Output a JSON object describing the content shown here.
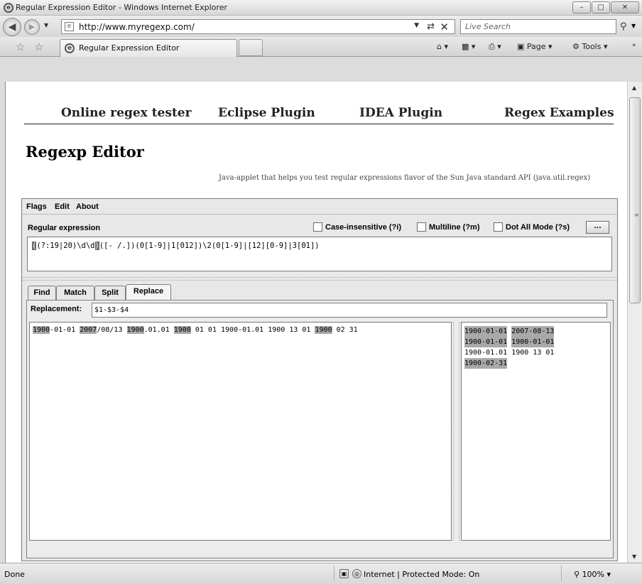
{
  "window": {
    "title": "Regular Expression Editor - Windows Internet Explorer",
    "controls": [
      "minimize",
      "maximize",
      "close"
    ]
  },
  "navigation": {
    "url": "http://www.myregexp.com/",
    "search_placeholder": "Live Search"
  },
  "tab": {
    "title": "Regular Expression Editor"
  },
  "command_bar": {
    "page_label": "Page",
    "tools_label": "Tools"
  },
  "site": {
    "nav": [
      "Online regex tester",
      "Eclipse Plugin",
      "IDEA Plugin",
      "Regex Examples"
    ],
    "heading": "Regexp Editor",
    "tagline": "Java-applet that helps you test regular expressions flavor of the Sun Java standard API (java.util.regex)"
  },
  "applet": {
    "menu": [
      "Flags",
      "Edit",
      "About"
    ],
    "regex_label": "Regular expression",
    "flags": [
      {
        "label": "Case-insensitive (?i)",
        "checked": false
      },
      {
        "label": "Multiline (?m)",
        "checked": false
      },
      {
        "label": "Dot All Mode (?s)",
        "checked": false
      }
    ],
    "more_button": "...",
    "regex": {
      "open_paren": "(",
      "group1": "(?:19|20)\\d\\d",
      "close_paren": ")",
      "rest": "([- /.])(0[1-9]|1[012])\\2(0[1-9]|[12][0-9]|3[01])"
    },
    "tabs": [
      "Find",
      "Match",
      "Split",
      "Replace"
    ],
    "active_tab": "Replace",
    "replacement_label": "Replacement:",
    "replacement_value": "$1-$3-$4",
    "subject_segments": [
      {
        "text": "1900",
        "match": true
      },
      {
        "text": "-01-01 ",
        "match": false
      },
      {
        "text": "2007",
        "match": true
      },
      {
        "text": "/08/13 ",
        "match": false
      },
      {
        "text": "1900",
        "match": true
      },
      {
        "text": ".01.01 ",
        "match": false
      },
      {
        "text": "1900",
        "match": true
      },
      {
        "text": " 01 01 1900-01.01 1900 13 01 ",
        "match": false
      },
      {
        "text": "1900",
        "match": true
      },
      {
        "text": " 02 31",
        "match": false
      }
    ],
    "results": [
      {
        "text": "1900-01-01",
        "match": true
      },
      {
        "text": "2007-08-13",
        "match": true
      },
      {
        "text": "1900-01-01",
        "match": true
      },
      {
        "text": "1900-01-01",
        "match": true
      },
      {
        "text": "1900-01.01",
        "match": false
      },
      {
        "text": "1900 13 01",
        "match": false
      },
      {
        "text": "1900-02-31",
        "match": true
      }
    ]
  },
  "status": {
    "left": "Done",
    "zone": "Internet | Protected Mode: On",
    "zoom": "100%"
  },
  "colors": {
    "match_highlight": "#a9a9a9",
    "group_highlight": "#6c6c6c"
  }
}
